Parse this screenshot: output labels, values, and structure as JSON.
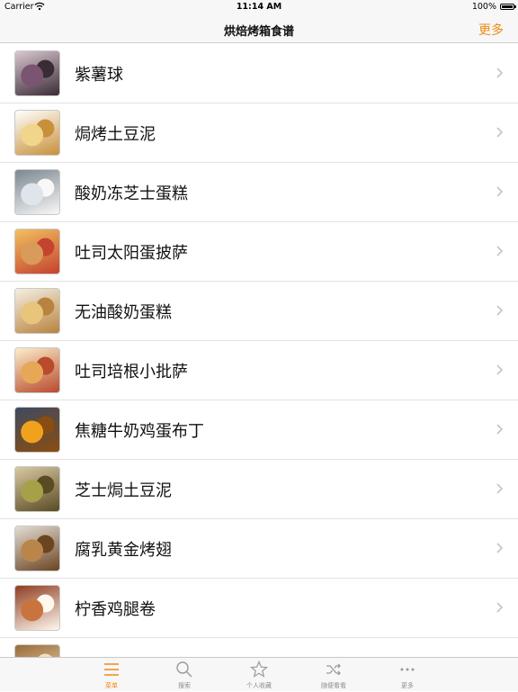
{
  "status_bar": {
    "carrier": "Carrier",
    "time": "11:14 AM",
    "battery": "100%"
  },
  "nav": {
    "title": "烘焙烤箱食谱",
    "more": "更多"
  },
  "accent_color": "#f08a16",
  "recipes": [
    {
      "title": "紫薯球",
      "thumb": [
        "#7a5470",
        "#3a2c35",
        "#d9c7d1"
      ]
    },
    {
      "title": "焗烤土豆泥",
      "thumb": [
        "#f1d58a",
        "#c8903b",
        "#ffffff"
      ]
    },
    {
      "title": "酸奶冻芝士蛋糕",
      "thumb": [
        "#dfe5ea",
        "#f8f8f8",
        "#7c8790"
      ]
    },
    {
      "title": "吐司太阳蛋披萨",
      "thumb": [
        "#d99b5a",
        "#c4432f",
        "#f2c060"
      ]
    },
    {
      "title": "无油酸奶蛋糕",
      "thumb": [
        "#e8c57a",
        "#b8833e",
        "#f4efe4"
      ]
    },
    {
      "title": "吐司培根小批萨",
      "thumb": [
        "#e6a857",
        "#b94a2c",
        "#fbeecb"
      ]
    },
    {
      "title": "焦糖牛奶鸡蛋布丁",
      "thumb": [
        "#f0a21d",
        "#8a4d11",
        "#3e4a60"
      ]
    },
    {
      "title": "芝士焗土豆泥",
      "thumb": [
        "#a6a048",
        "#5a4b23",
        "#d8c9a3"
      ]
    },
    {
      "title": "腐乳黄金烤翅",
      "thumb": [
        "#b9854a",
        "#6b4421",
        "#e3ddd4"
      ]
    },
    {
      "title": "柠香鸡腿卷",
      "thumb": [
        "#c8743f",
        "#fff8ee",
        "#8e3d21"
      ]
    },
    {
      "title": "",
      "thumb": [
        "#e3b264",
        "#f3e1bd",
        "#9a6c3a"
      ]
    }
  ],
  "tabs": [
    {
      "label": "菜单",
      "icon": "menu-icon",
      "active": true
    },
    {
      "label": "搜索",
      "icon": "search-icon",
      "active": false
    },
    {
      "label": "个人收藏",
      "icon": "star-icon",
      "active": false
    },
    {
      "label": "随便看看",
      "icon": "shuffle-icon",
      "active": false
    },
    {
      "label": "更多",
      "icon": "more-icon",
      "active": false
    }
  ]
}
